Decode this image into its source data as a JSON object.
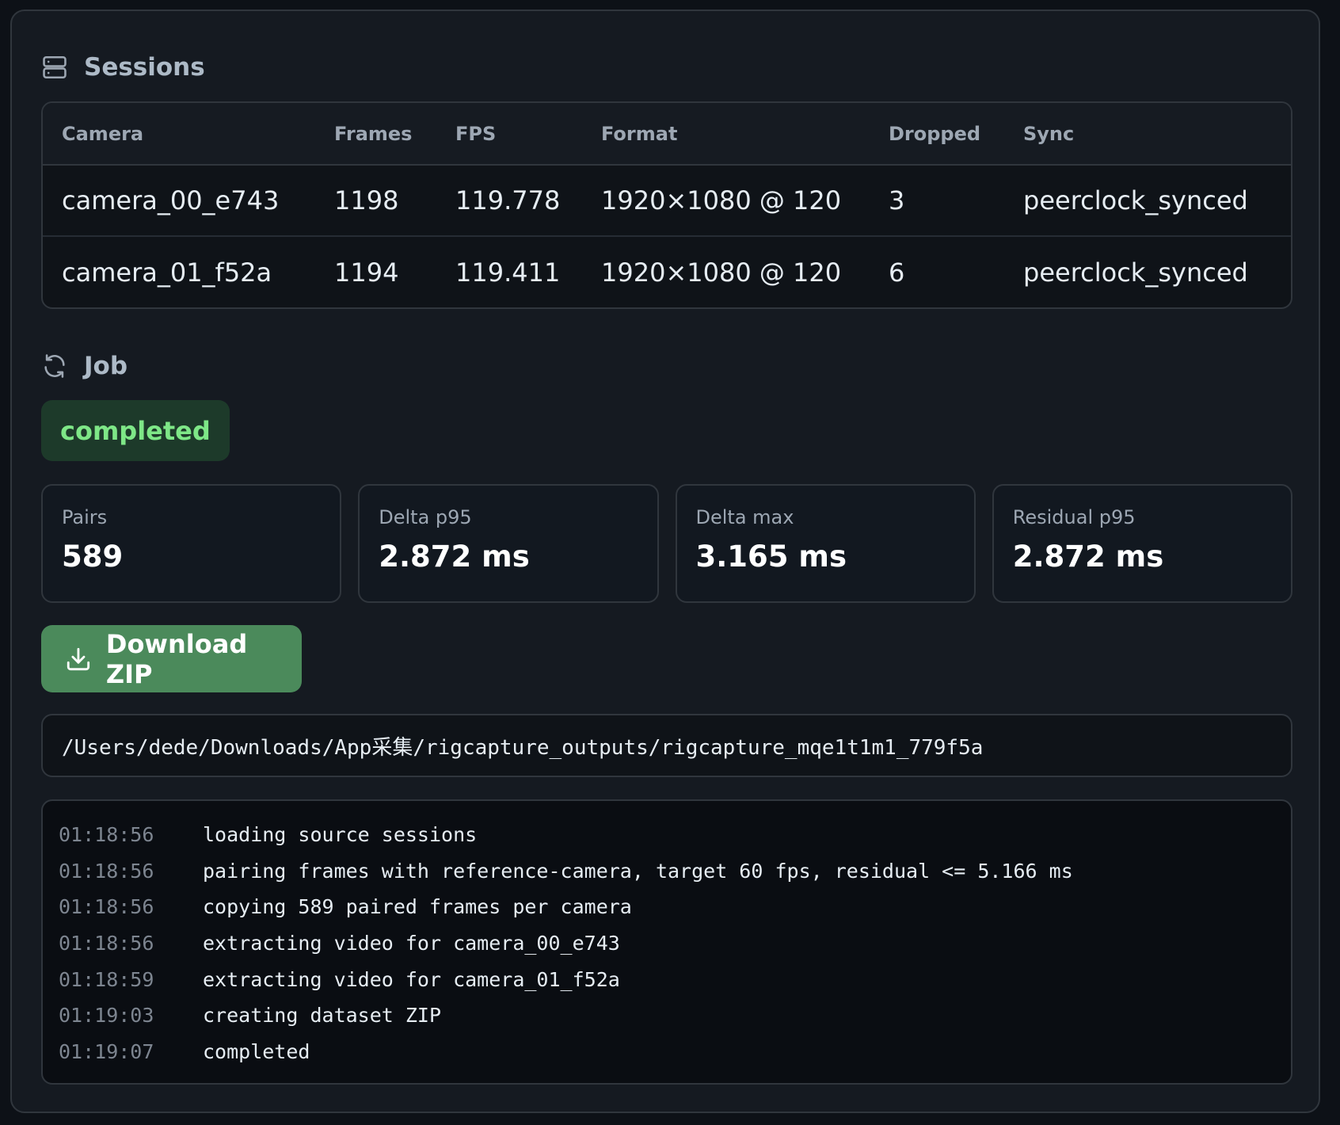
{
  "sessions": {
    "title": "Sessions",
    "icon": "server-icon",
    "columns": [
      "Camera",
      "Frames",
      "FPS",
      "Format",
      "Dropped",
      "Sync"
    ],
    "rows": [
      {
        "camera": "camera_00_e743",
        "frames": "1198",
        "fps": "119.778",
        "format": "1920×1080 @ 120",
        "dropped": "3",
        "sync": "peerclock_synced"
      },
      {
        "camera": "camera_01_f52a",
        "frames": "1194",
        "fps": "119.411",
        "format": "1920×1080 @ 120",
        "dropped": "6",
        "sync": "peerclock_synced"
      }
    ]
  },
  "job": {
    "title": "Job",
    "icon": "refresh-icon",
    "status": "completed",
    "status_color": "#7ee787",
    "stats": [
      {
        "label": "Pairs",
        "value": "589"
      },
      {
        "label": "Delta p95",
        "value": "2.872 ms"
      },
      {
        "label": "Delta max",
        "value": "3.165 ms"
      },
      {
        "label": "Residual p95",
        "value": "2.872 ms"
      }
    ],
    "download_label": "Download ZIP",
    "download_icon": "download-icon",
    "accent_color": "#4b8a5b",
    "output_path": "/Users/dede/Downloads/App采集/rigcapture_outputs/rigcapture_mqe1t1m1_779f5a",
    "log": [
      {
        "time": "01:18:56",
        "message": "loading source sessions"
      },
      {
        "time": "01:18:56",
        "message": "pairing frames with reference-camera, target 60 fps, residual <= 5.166 ms"
      },
      {
        "time": "01:18:56",
        "message": "copying 589 paired frames per camera"
      },
      {
        "time": "01:18:56",
        "message": "extracting video for camera_00_e743"
      },
      {
        "time": "01:18:59",
        "message": "extracting video for camera_01_f52a"
      },
      {
        "time": "01:19:03",
        "message": "creating dataset ZIP"
      },
      {
        "time": "01:19:07",
        "message": "completed"
      }
    ]
  }
}
